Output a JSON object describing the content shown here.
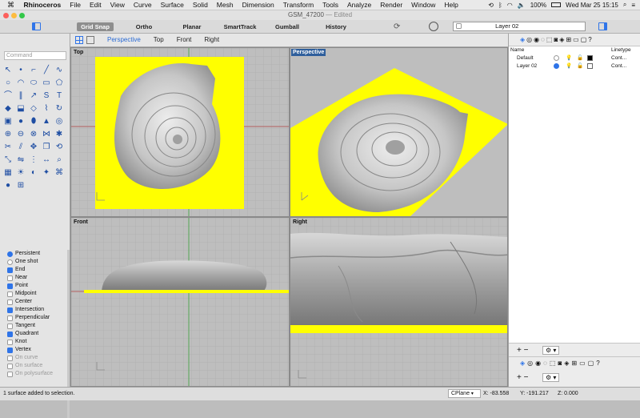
{
  "menubar": {
    "apple": "⌘",
    "app_name": "Rhinoceros",
    "items": [
      "File",
      "Edit",
      "View",
      "Curve",
      "Surface",
      "Solid",
      "Mesh",
      "Dimension",
      "Transform",
      "Tools",
      "Analyze",
      "Render",
      "Window",
      "Help"
    ],
    "battery": "100%",
    "clock": "Wed Mar 25  15:15"
  },
  "window": {
    "title": "GSM_47200",
    "edited": "— Edited"
  },
  "toolbar": {
    "buttons": [
      {
        "label": "Grid Snap",
        "active": true
      },
      {
        "label": "Ortho",
        "active": false
      },
      {
        "label": "Planar",
        "active": false
      },
      {
        "label": "SmartTrack",
        "active": false
      },
      {
        "label": "Gumball",
        "active": false
      },
      {
        "label": "History",
        "active": false
      }
    ],
    "current_layer": "Layer 02"
  },
  "viewport_tabs": [
    "Perspective",
    "Top",
    "Front",
    "Right"
  ],
  "command": {
    "placeholder": "Command"
  },
  "osnap": {
    "modes": [
      {
        "label": "Persistent",
        "selected": true
      },
      {
        "label": "One shot",
        "selected": false
      }
    ],
    "items": [
      {
        "label": "End",
        "checked": true,
        "enabled": true
      },
      {
        "label": "Near",
        "checked": false,
        "enabled": true
      },
      {
        "label": "Point",
        "checked": true,
        "enabled": true
      },
      {
        "label": "Midpoint",
        "checked": false,
        "enabled": true
      },
      {
        "label": "Center",
        "checked": false,
        "enabled": true
      },
      {
        "label": "Intersection",
        "checked": true,
        "enabled": true
      },
      {
        "label": "Perpendicular",
        "checked": false,
        "enabled": true
      },
      {
        "label": "Tangent",
        "checked": false,
        "enabled": true
      },
      {
        "label": "Quadrant",
        "checked": true,
        "enabled": true
      },
      {
        "label": "Knot",
        "checked": false,
        "enabled": true
      },
      {
        "label": "Vertex",
        "checked": true,
        "enabled": true
      },
      {
        "label": "On curve",
        "checked": false,
        "enabled": false
      },
      {
        "label": "On surface",
        "checked": false,
        "enabled": false
      },
      {
        "label": "On polysurface",
        "checked": false,
        "enabled": false
      }
    ]
  },
  "viewports": [
    {
      "label": "Top",
      "active": false
    },
    {
      "label": "Perspective",
      "active": true
    },
    {
      "label": "Front",
      "active": false
    },
    {
      "label": "Right",
      "active": false
    }
  ],
  "layers": {
    "columns": {
      "name": "Name",
      "linetype": "Linetype"
    },
    "rows": [
      {
        "name": "Default",
        "linetype": "Cont...",
        "current": false,
        "color": "#000000"
      },
      {
        "name": "Layer 02",
        "linetype": "Cont...",
        "current": true,
        "color": "#ffffff"
      }
    ]
  },
  "status": {
    "message": "1 surface added to selection.",
    "cplane": "CPlane",
    "x": "X: -83.558",
    "y": "Y: -191.217",
    "z": "Z: 0.000"
  },
  "colors": {
    "accent": "#2f74e8",
    "plane": "#ffff00",
    "active_label": "#2f5f9c"
  }
}
